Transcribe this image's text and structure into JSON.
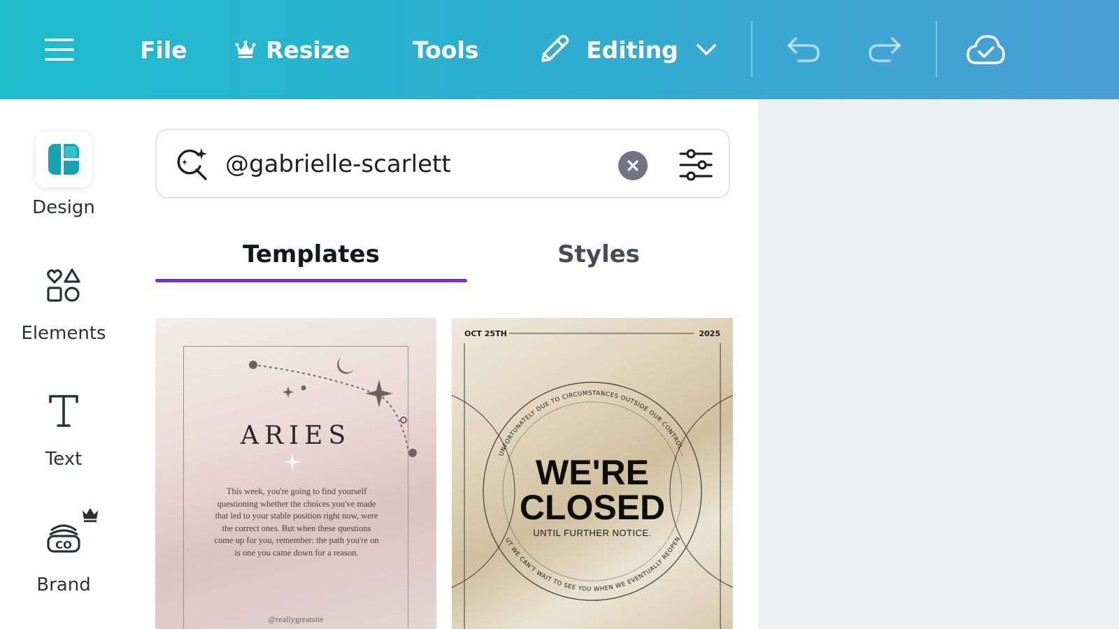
{
  "topbar": {
    "menu_icon": "hamburger-menu-icon",
    "file_label": "File",
    "resize_label": "Resize",
    "resize_icon": "crown-icon",
    "tools_label": "Tools",
    "editing_label": "Editing",
    "editing_icon": "pencil-icon",
    "undo_icon": "undo-icon",
    "redo_icon": "redo-icon",
    "save_icon": "cloud-check-icon",
    "colors": {
      "gradient_start": "#1fbccc",
      "gradient_end": "#4a9ed6"
    }
  },
  "sidebar": {
    "items": [
      {
        "label": "Design",
        "icon": "design-layout-icon",
        "active": true
      },
      {
        "label": "Elements",
        "icon": "shapes-icon",
        "active": false
      },
      {
        "label": "Text",
        "icon": "text-icon",
        "active": false
      },
      {
        "label": "Brand",
        "icon": "brand-kit-icon",
        "badge_icon": "crown-icon",
        "active": false
      }
    ]
  },
  "search": {
    "value": "@gabrielle-scarlett",
    "icon": "magic-search-icon",
    "clear_icon": "clear-icon",
    "filter_icon": "filter-sliders-icon"
  },
  "tabs": [
    {
      "label": "Templates",
      "selected": true
    },
    {
      "label": "Styles",
      "selected": false
    }
  ],
  "accent_color": "#7d2ae8",
  "templates": [
    {
      "title": "ARIES",
      "body": "This week, you're going to find yourself questioning whether the choices you've made that led to your stable position right now, were the correct ones. But when these questions come up for you, remember: the path you're on is one you came down for a reason.",
      "handle": "@reallygreatsite"
    },
    {
      "date_left": "OCT 25TH",
      "date_right": "2025",
      "arc_top": "UNFORTUNATELY DUE TO CIRCUMSTANCES OUTSIDE OUR CONTROL...",
      "headline_line1": "WE'RE",
      "headline_line2": "CLOSED",
      "subline": "UNTIL FURTHER NOTICE.",
      "arc_bottom": "BUT WE CAN'T WAIT TO SEE YOU WHEN WE EVENTUALLY REOPEN!"
    }
  ]
}
